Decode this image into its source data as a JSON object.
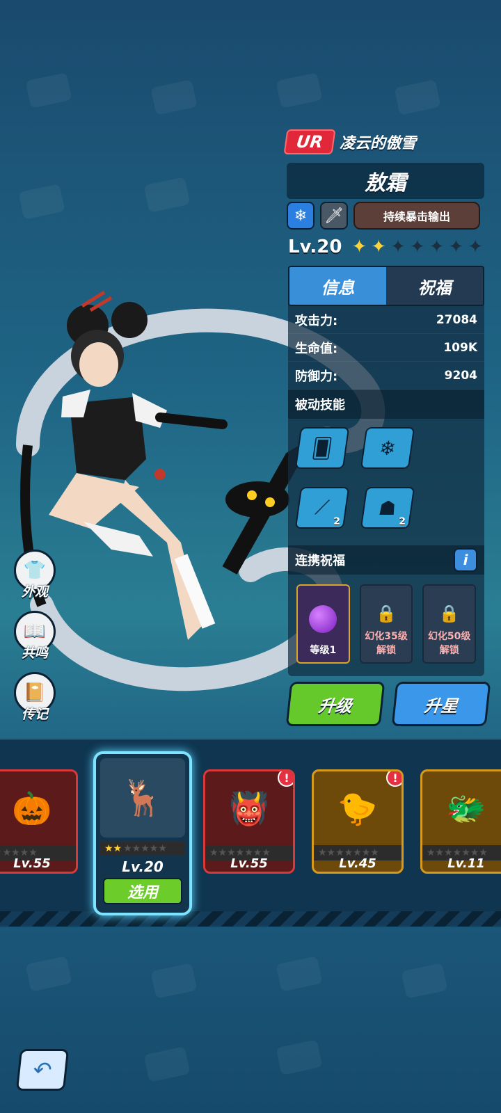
{
  "hero": {
    "rarity": "UR",
    "subtitle": "凌云的傲雪",
    "name": "敖霜",
    "element_icon": "snowflake-icon",
    "weapon_icon": "sword-icon",
    "role_tag": "持续暴击输出",
    "level": "Lv.20",
    "stars_total": 7,
    "stars_filled": 2
  },
  "tabs": [
    {
      "label": "信息",
      "active": true
    },
    {
      "label": "祝福",
      "active": false
    }
  ],
  "stats": [
    {
      "label": "攻击力:",
      "value": "27084"
    },
    {
      "label": "生命值:",
      "value": "109K"
    },
    {
      "label": "防御力:",
      "value": "9204"
    }
  ],
  "passive": {
    "title": "被动技能",
    "skills": [
      {
        "icon": "cards-dice-icon",
        "count": ""
      },
      {
        "icon": "snowflakes-icon",
        "count": ""
      },
      {
        "icon": "claw-slash-icon",
        "count": "2"
      },
      {
        "icon": "dragon-head-icon",
        "count": "2"
      }
    ]
  },
  "link_blessing": {
    "title": "连携祝福",
    "info_label": "i",
    "items": [
      {
        "label": "等级1",
        "locked": false
      },
      {
        "label": "幻化35级",
        "sub": "解锁",
        "locked": true
      },
      {
        "label": "幻化50级",
        "sub": "解锁",
        "locked": true
      }
    ]
  },
  "actions": {
    "upgrade": "升级",
    "star_up": "升星"
  },
  "side_menu": [
    {
      "label": "外观",
      "icon": "shirt-icon"
    },
    {
      "label": "共鸣",
      "icon": "book-icon"
    },
    {
      "label": "传记",
      "icon": "journal-icon"
    }
  ],
  "roster": [
    {
      "level": "Lv.55",
      "stars": 1,
      "frame": "red",
      "badge": false
    },
    {
      "level": "Lv.20",
      "stars": 2,
      "frame": "selected",
      "badge": false,
      "use_label": "选用"
    },
    {
      "level": "Lv.55",
      "stars": 0,
      "frame": "red",
      "badge": true
    },
    {
      "level": "Lv.45",
      "stars": 0,
      "frame": "gold",
      "badge": true
    },
    {
      "level": "Lv.11",
      "stars": 0,
      "frame": "gold",
      "badge": false
    }
  ],
  "colors": {
    "accent_blue": "#3b97ea",
    "accent_green": "#65c92b",
    "rarity_red": "#e0283a",
    "star_gold": "#ffd23a"
  }
}
